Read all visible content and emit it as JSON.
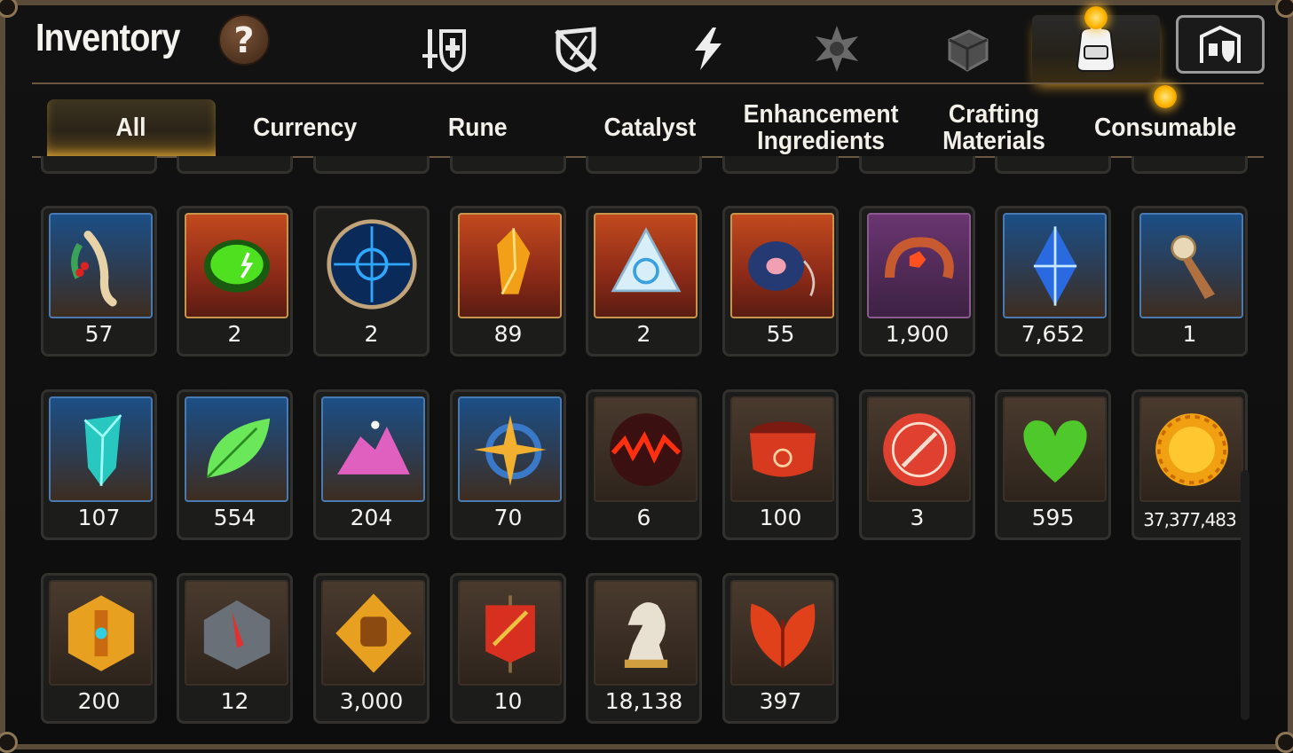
{
  "header": {
    "title": "Inventory",
    "help_label": "?",
    "category_icons": [
      "hero-equipment-icon",
      "broken-shield-icon",
      "lightning-icon",
      "star-emblem-icon",
      "cube-icon",
      "backpack-icon"
    ],
    "active_category": "backpack-icon"
  },
  "tabs": [
    {
      "label": "All",
      "active": true
    },
    {
      "label": "Currency",
      "active": false
    },
    {
      "label": "Rune",
      "active": false
    },
    {
      "label": "Catalyst",
      "active": false
    },
    {
      "label": "Enhancement Ingredients",
      "active": false
    },
    {
      "label": "Crafting Materials",
      "active": false
    },
    {
      "label": "Consumable",
      "active": false
    }
  ],
  "colors": {
    "frame": "#5b4c3a",
    "accent_gold": "#ffb400",
    "active_tab_glow": "#ffbe3c"
  },
  "items": [
    {
      "icon": "ginseng-root-icon",
      "qty": "57",
      "frame": "blue"
    },
    {
      "icon": "green-potion-icon",
      "qty": "2",
      "frame": "red"
    },
    {
      "icon": "blue-rune-orb-icon",
      "qty": "2",
      "frame": "round"
    },
    {
      "icon": "amber-crystal-icon",
      "qty": "89",
      "frame": "red"
    },
    {
      "icon": "triangle-crystal-icon",
      "qty": "2",
      "frame": "red"
    },
    {
      "icon": "disc-pendant-icon",
      "qty": "55",
      "frame": "red"
    },
    {
      "icon": "flame-ring-icon",
      "qty": "1,900",
      "frame": "purple"
    },
    {
      "icon": "blue-gem-icon",
      "qty": "7,652",
      "frame": "blue"
    },
    {
      "icon": "quill-charm-icon",
      "qty": "1",
      "frame": "blue"
    },
    {
      "icon": "teal-crystal-icon",
      "qty": "107",
      "frame": "blue"
    },
    {
      "icon": "green-leaf-icon",
      "qty": "554",
      "frame": "blue"
    },
    {
      "icon": "pink-ore-icon",
      "qty": "204",
      "frame": "blue"
    },
    {
      "icon": "star-compass-icon",
      "qty": "70",
      "frame": "blue"
    },
    {
      "icon": "fire-orb-icon",
      "qty": "6",
      "frame": "brown"
    },
    {
      "icon": "red-cuff-icon",
      "qty": "100",
      "frame": "brown"
    },
    {
      "icon": "red-seal-icon",
      "qty": "3",
      "frame": "brown"
    },
    {
      "icon": "green-heart-icon",
      "qty": "595",
      "frame": "brown"
    },
    {
      "icon": "gold-sun-coin-icon",
      "qty": "37,377,483",
      "frame": "brown"
    },
    {
      "icon": "gold-emblem-icon",
      "qty": "200",
      "frame": "brown"
    },
    {
      "icon": "stone-compass-icon",
      "qty": "12",
      "frame": "brown"
    },
    {
      "icon": "fist-badge-icon",
      "qty": "3,000",
      "frame": "brown"
    },
    {
      "icon": "war-banner-icon",
      "qty": "10",
      "frame": "brown"
    },
    {
      "icon": "knight-chess-icon",
      "qty": "18,138",
      "frame": "brown"
    },
    {
      "icon": "red-leaf-icon",
      "qty": "397",
      "frame": "brown"
    }
  ]
}
